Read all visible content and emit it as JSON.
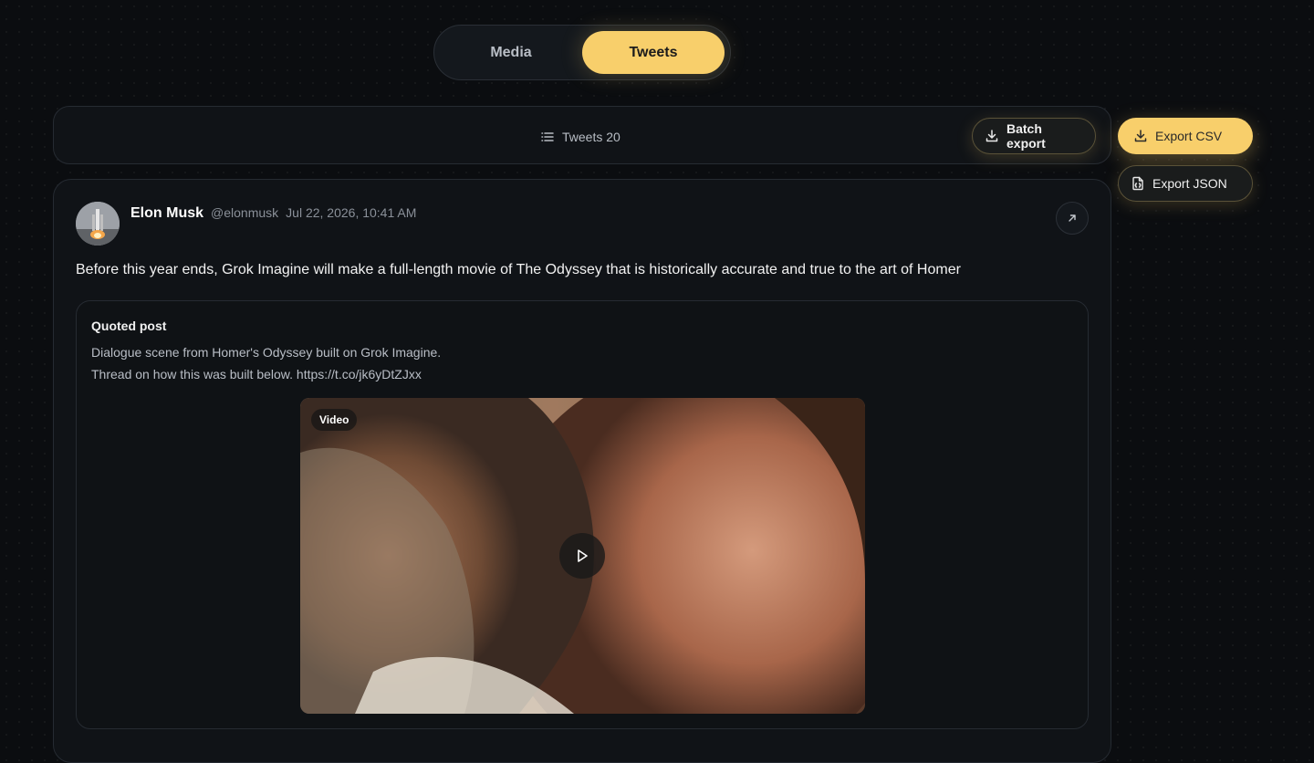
{
  "tabs": {
    "media": "Media",
    "tweets": "Tweets",
    "active": "tweets"
  },
  "toolbar": {
    "count_label": "Tweets 20",
    "batch_export": "Batch export",
    "export_csv": "Export CSV",
    "export_json": "Export JSON"
  },
  "tweet": {
    "author_name": "Elon Musk",
    "author_handle": "@elonmusk",
    "timestamp": "Jul 22, 2026, 10:41 AM",
    "text": "Before this year ends, Grok Imagine will make a full-length movie of The Odyssey that is historically accurate and true to the art of Homer",
    "quote": {
      "title": "Quoted post",
      "line1": "Dialogue scene from Homer's Odyssey built on Grok Imagine.",
      "line2": "Thread on how this was built below. https://t.co/jk6yDtZJxx",
      "media_tag": "Video"
    }
  },
  "colors": {
    "accent": "#f8cf6b",
    "background": "#0b0d10",
    "card": "#101317"
  },
  "icons": [
    "list-icon",
    "download-icon",
    "file-json-icon",
    "external-link-icon",
    "play-icon"
  ]
}
